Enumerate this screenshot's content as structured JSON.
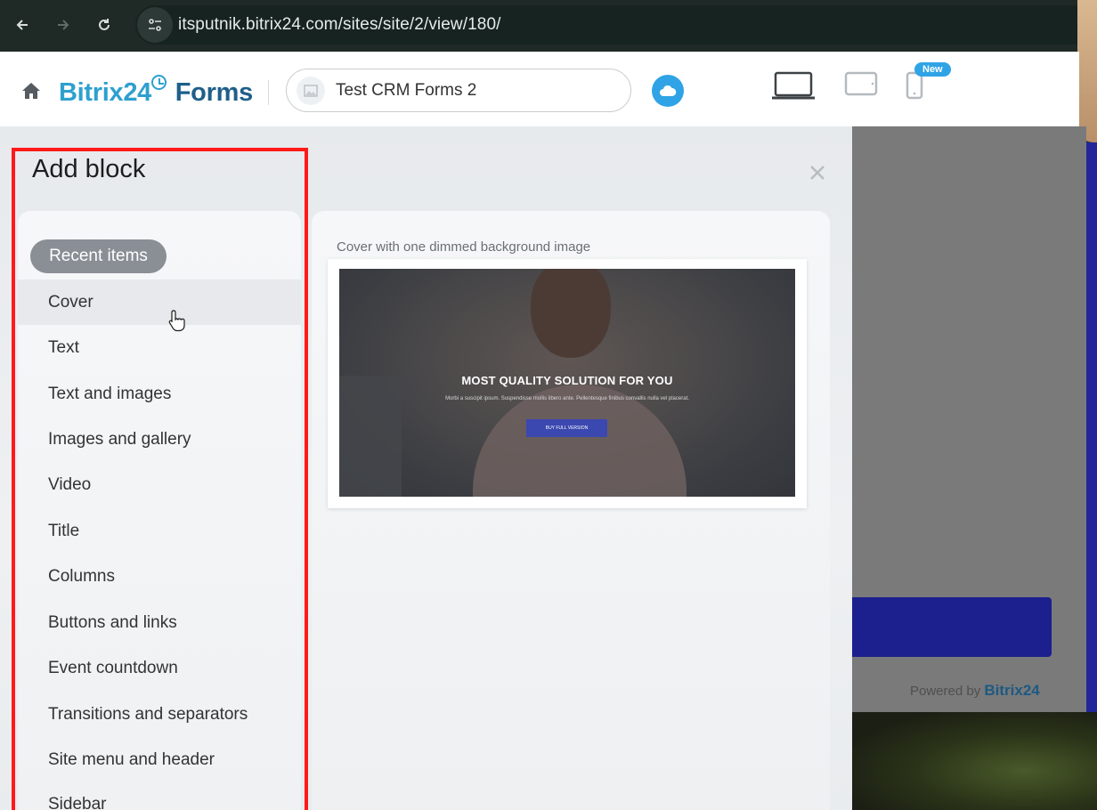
{
  "browser": {
    "url": "itsputnik.bitrix24.com/sites/site/2/view/180/"
  },
  "header": {
    "brand_main": "Bitrix24",
    "brand_suffix": "Forms",
    "site_name": "Test CRM Forms 2",
    "new_badge": "New"
  },
  "panel": {
    "title": "Add block",
    "categories": [
      "Recent items",
      "Cover",
      "Text",
      "Text and images",
      "Images and gallery",
      "Video",
      "Title",
      "Columns",
      "Buttons and links",
      "Event countdown",
      "Transitions and separators",
      "Site menu and header",
      "Sidebar"
    ]
  },
  "block_preview": {
    "caption": "Cover with one dimmed background image",
    "headline": "MOST QUALITY SOLUTION FOR YOU",
    "subtext": "Morbi a suscipit ipsum. Suspendisse mollis libero ante. Pellentesque finibus convallis nulla vel placerat.",
    "button": "BUY FULL VERSION"
  },
  "preview_page": {
    "powered_by": "Powered by",
    "powered_brand": "Bitrix24"
  },
  "colors": {
    "highlight_frame": "#ff1a1a",
    "accent": "#2fa3e6",
    "cta": "#1c1f8e"
  }
}
